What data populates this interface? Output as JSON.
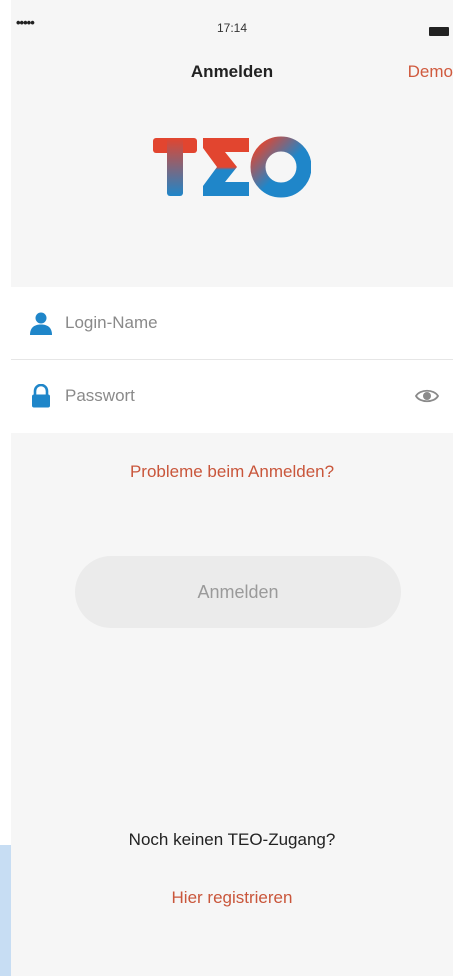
{
  "status_bar": {
    "signal": "•••••",
    "time": "17:14"
  },
  "nav": {
    "title": "Anmelden",
    "demo_label": "Demo"
  },
  "logo": {
    "text": "TΣO"
  },
  "form": {
    "login_placeholder": "Login-Name",
    "password_placeholder": "Passwort"
  },
  "links": {
    "problems": "Probleme beim Anmelden?",
    "register": "Hier registrieren"
  },
  "login_button_label": "Anmelden",
  "no_account_text": "Noch keinen TEO-Zugang?",
  "colors": {
    "accent": "#c9563b",
    "icon_blue": "#1f86c9",
    "background": "#f6f6f6"
  }
}
